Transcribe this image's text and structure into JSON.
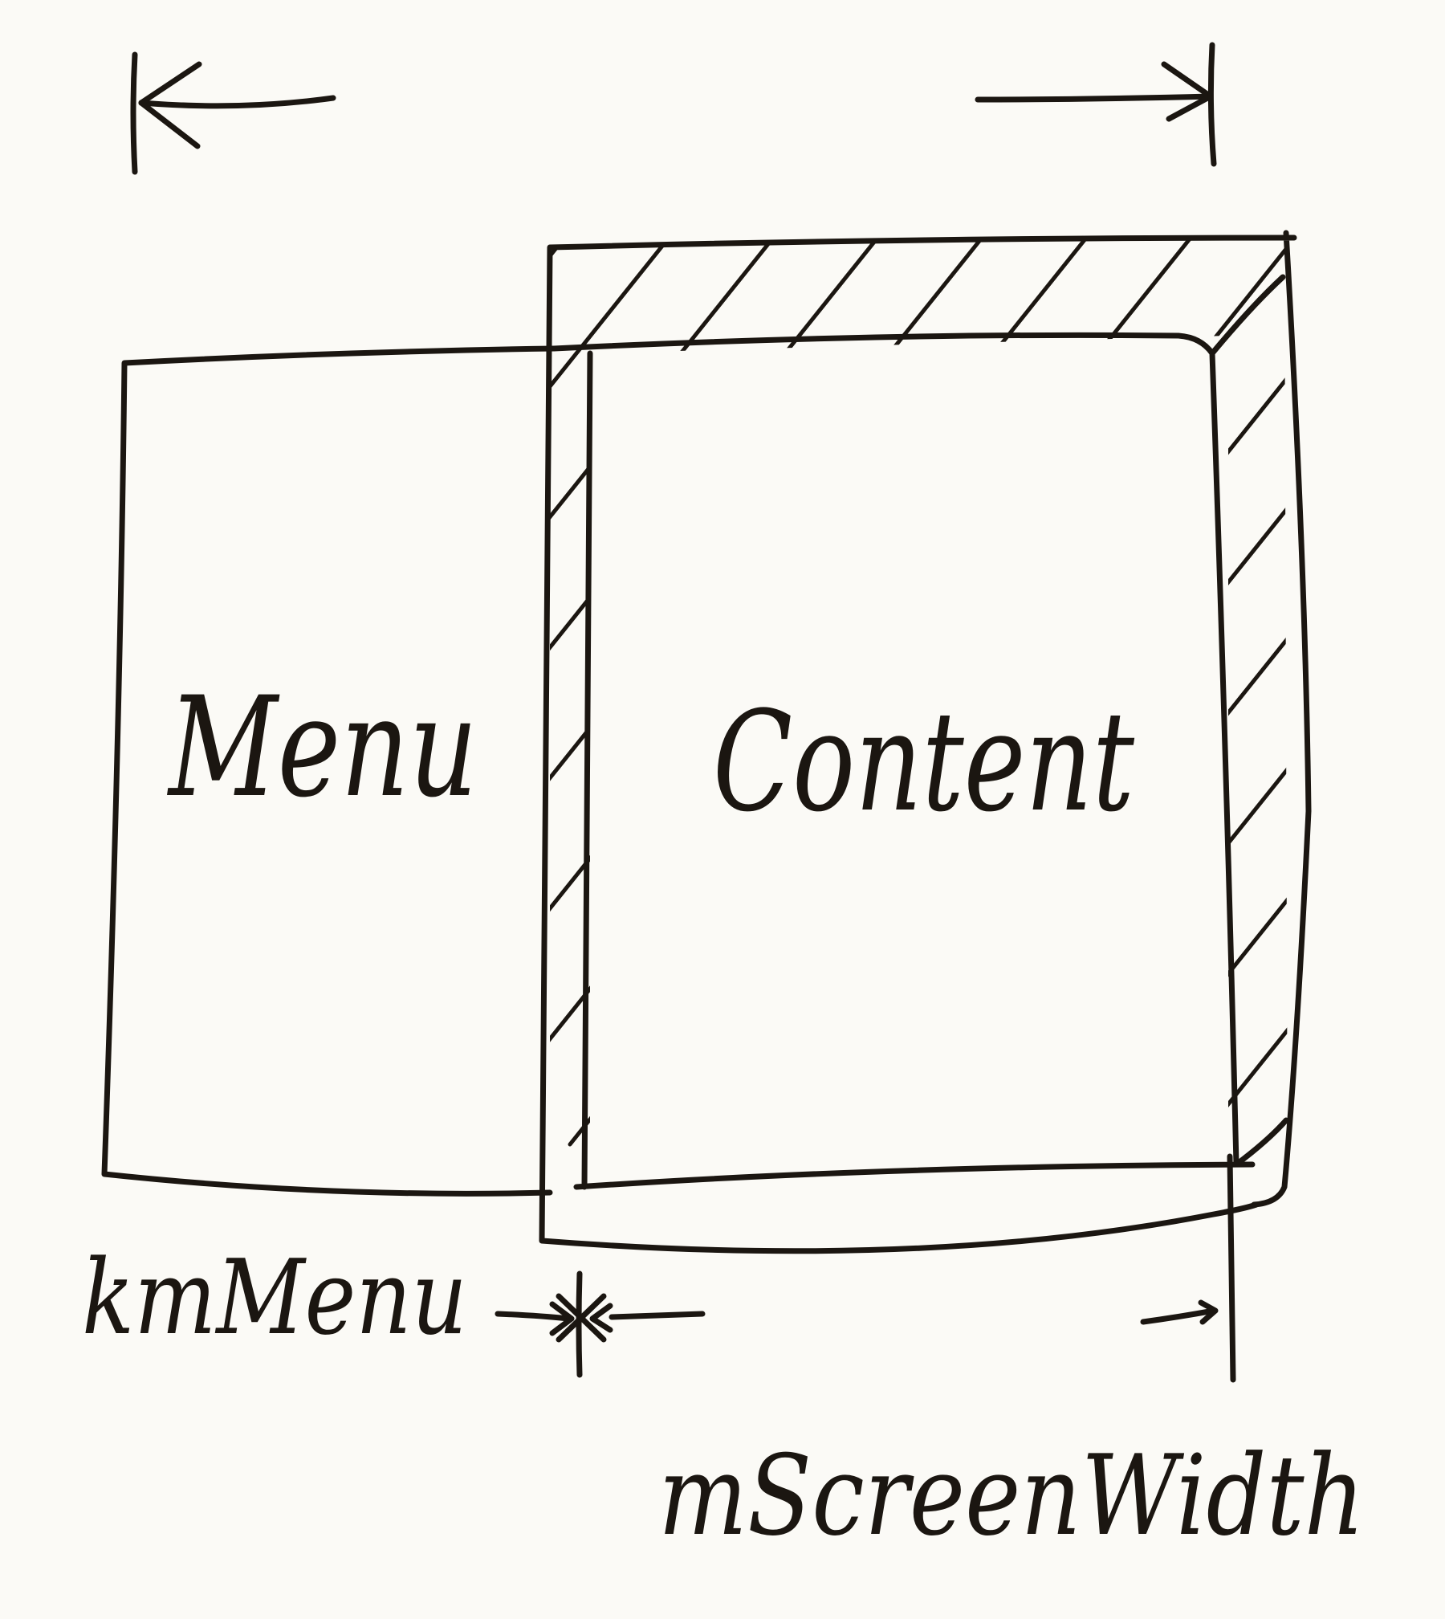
{
  "labels": {
    "menu": "Menu",
    "content": "Content",
    "menu_width": "kmMenu",
    "screen_width": "mScreenWidth"
  },
  "colors": {
    "ink": "#1b1611",
    "paper": "#fbfaf6"
  }
}
